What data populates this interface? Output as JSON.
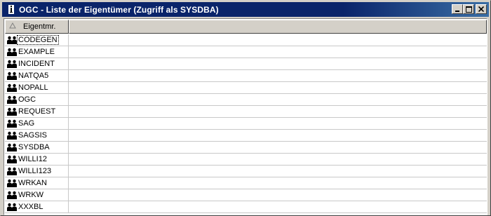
{
  "window": {
    "title": "OGC - Liste der Eigentümer (Zugriff als SYSDBA)",
    "icon": "info-icon",
    "buttons": [
      "minimize",
      "maximize",
      "close"
    ]
  },
  "table": {
    "columns": [
      {
        "label": "Eigentmr.",
        "sort_icon": "sort-indicator-icon"
      },
      {
        "label": ""
      }
    ],
    "selected_index": 0,
    "rows": [
      {
        "name": "CODEGEN",
        "icon": "user-group-icon"
      },
      {
        "name": "EXAMPLE",
        "icon": "user-group-icon"
      },
      {
        "name": "INCIDENT",
        "icon": "user-group-icon"
      },
      {
        "name": "NATQA5",
        "icon": "user-group-icon"
      },
      {
        "name": "NOPALL",
        "icon": "user-group-icon"
      },
      {
        "name": "OGC",
        "icon": "user-group-icon"
      },
      {
        "name": "REQUEST",
        "icon": "user-group-icon"
      },
      {
        "name": "SAG",
        "icon": "user-group-icon"
      },
      {
        "name": "SAGSIS",
        "icon": "user-group-icon"
      },
      {
        "name": "SYSDBA",
        "icon": "user-group-icon"
      },
      {
        "name": "WILLI12",
        "icon": "user-group-icon"
      },
      {
        "name": "WILLI123",
        "icon": "user-group-icon"
      },
      {
        "name": "WRKAN",
        "icon": "user-group-icon"
      },
      {
        "name": "WRKW",
        "icon": "user-group-icon"
      },
      {
        "name": "XXXBL",
        "icon": "user-group-icon"
      }
    ]
  }
}
